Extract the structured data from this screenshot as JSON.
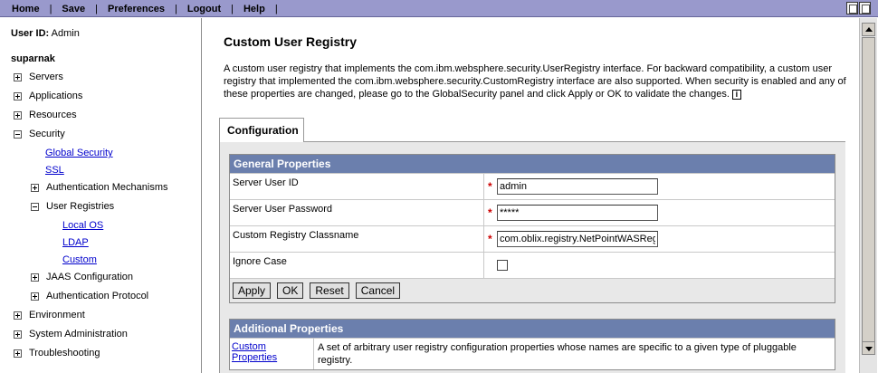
{
  "menu": {
    "items": [
      "Home",
      "Save",
      "Preferences",
      "Logout",
      "Help"
    ]
  },
  "nav": {
    "user_label": "User ID:",
    "user_value": "Admin",
    "node": "suparnak",
    "servers": "Servers",
    "applications": "Applications",
    "resources": "Resources",
    "security": "Security",
    "global_security": "Global Security",
    "ssl": "SSL",
    "auth_mechanisms": "Authentication Mechanisms",
    "user_registries": "User Registries",
    "local_os": "Local OS",
    "ldap": "LDAP",
    "custom": "Custom",
    "jaas": "JAAS Configuration",
    "auth_protocol": "Authentication Protocol",
    "environment": "Environment",
    "system_admin": "System Administration",
    "troubleshooting": "Troubleshooting"
  },
  "page": {
    "title": "Custom User Registry",
    "description": "A custom user registry that implements the com.ibm.websphere.security.UserRegistry interface. For backward compatibility, a custom user registry that implemented the com.ibm.websphere.security.CustomRegistry interface are also supported. When security is enabled and any of these properties are changed, please go to the GlobalSecurity panel and click Apply or OK to validate the changes.",
    "info_icon": "i",
    "tab_label": "Configuration"
  },
  "general": {
    "heading": "General Properties",
    "required_mark": "*",
    "server_user_id_label": "Server User ID",
    "server_user_id_value": "admin",
    "server_user_password_label": "Server User Password",
    "server_user_password_value": "*****",
    "classname_label": "Custom Registry Classname",
    "classname_value": "com.oblix.registry.NetPointWASRegis",
    "ignore_case_label": "Ignore Case",
    "ignore_case_checked": false
  },
  "buttons": {
    "apply": "Apply",
    "ok": "OK",
    "reset": "Reset",
    "cancel": "Cancel"
  },
  "additional": {
    "heading": "Additional Properties",
    "link": "Custom Properties",
    "link_desc": "A set of arbitrary user registry configuration properties whose names are specific to a given type of pluggable registry."
  },
  "icons": {
    "expand": "plus-box-icon",
    "collapse": "minus-box-icon",
    "info": "info-icon",
    "print": "print-icon",
    "page": "page-icon"
  },
  "colors": {
    "menubar": "#9999cc",
    "section_header": "#6b7fad",
    "link": "#0000cc",
    "required": "#cc0000"
  }
}
